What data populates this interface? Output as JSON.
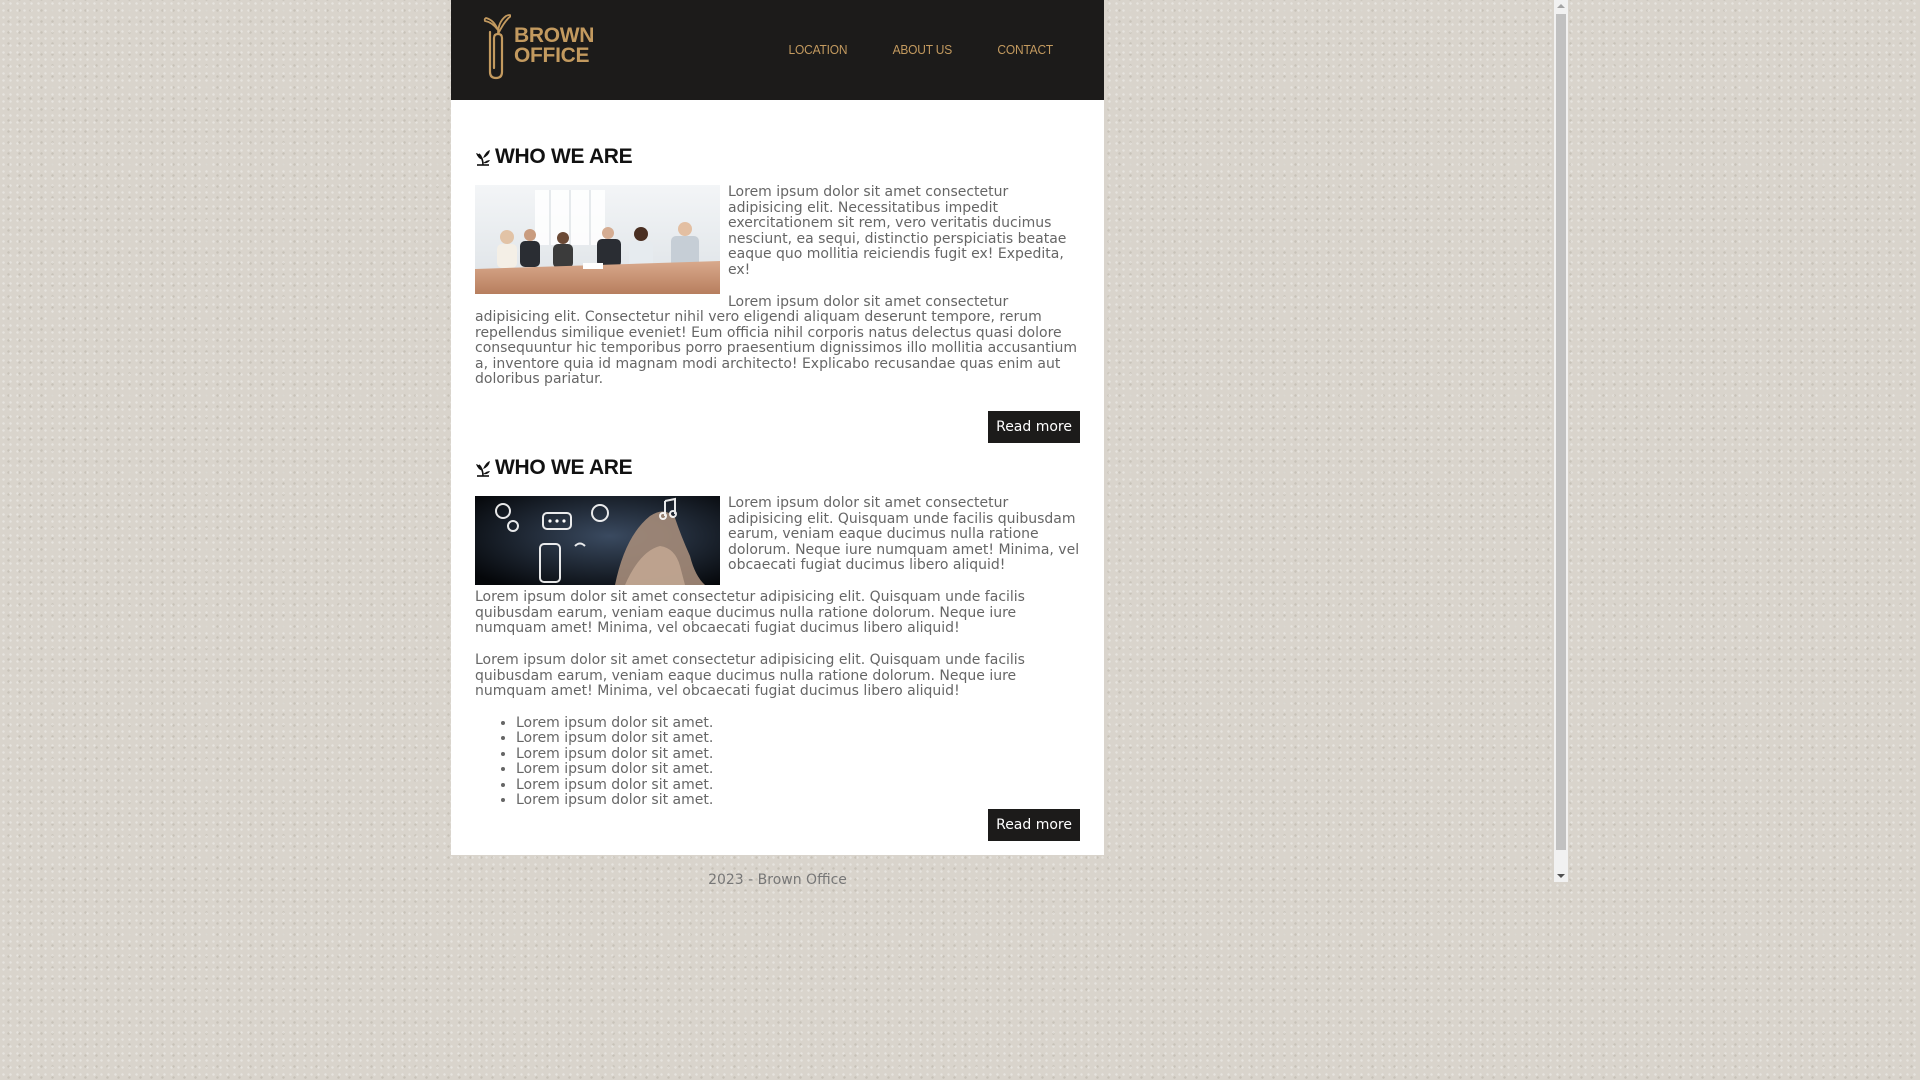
{
  "brand": {
    "line1": "BROWN",
    "line2": "OFFICE",
    "accent_color": "#c39a5f",
    "header_bg": "#1c1b1a"
  },
  "nav": {
    "items": [
      {
        "label": "LOCATION"
      },
      {
        "label": "ABOUT US"
      },
      {
        "label": "CONTACT"
      }
    ]
  },
  "sections": [
    {
      "title": "WHO WE ARE",
      "image_icon": "team-meeting-photo",
      "paragraphs": [
        "Lorem ipsum dolor sit amet consectetur adipisicing elit. Necessitatibus impedit exercitationem sit rem, vero veritatis ducimus nesciunt, ea sequi, distinctio perspiciatis beatae eaque quo mollitia reiciendis fugit ex! Expedita, ex!",
        "Lorem ipsum dolor sit amet consectetur adipisicing elit. Consectetur nihil vero eligendi aliquam deserunt tempore, rerum repellendus similique eveniet! Eum officia nihil corporis natus delectus quasi dolore consequuntur hic temporibus porro praesentium dignissimos illo mollitia accusantium a, inventore quia id magnam modi architecto! Explicabo recusandae quas enim aut doloribus pariatur."
      ],
      "button_label": "Read more"
    },
    {
      "title": "WHO WE ARE",
      "image_icon": "digital-hand-photo",
      "paragraphs": [
        "Lorem ipsum dolor sit amet consectetur adipisicing elit. Quisquam unde facilis quibusdam earum, veniam eaque ducimus nulla ratione dolorum. Neque iure numquam amet! Minima, vel obcaecati fugiat ducimus libero aliquid!",
        "Lorem ipsum dolor sit amet consectetur adipisicing elit. Quisquam unde facilis quibusdam earum, veniam eaque ducimus nulla ratione dolorum. Neque iure numquam amet! Minima, vel obcaecati fugiat ducimus libero aliquid!",
        "Lorem ipsum dolor sit amet consectetur adipisicing elit. Quisquam unde facilis quibusdam earum, veniam eaque ducimus nulla ratione dolorum. Neque iure numquam amet! Minima, vel obcaecati fugiat ducimus libero aliquid!"
      ],
      "list": [
        "Lorem ipsum dolor sit amet.",
        "Lorem ipsum dolor sit amet.",
        "Lorem ipsum dolor sit amet.",
        "Lorem ipsum dolor sit amet.",
        "Lorem ipsum dolor sit amet.",
        "Lorem ipsum dolor sit amet."
      ],
      "button_label": "Read more"
    }
  ],
  "footer": {
    "text": "2023 - Brown Office"
  }
}
